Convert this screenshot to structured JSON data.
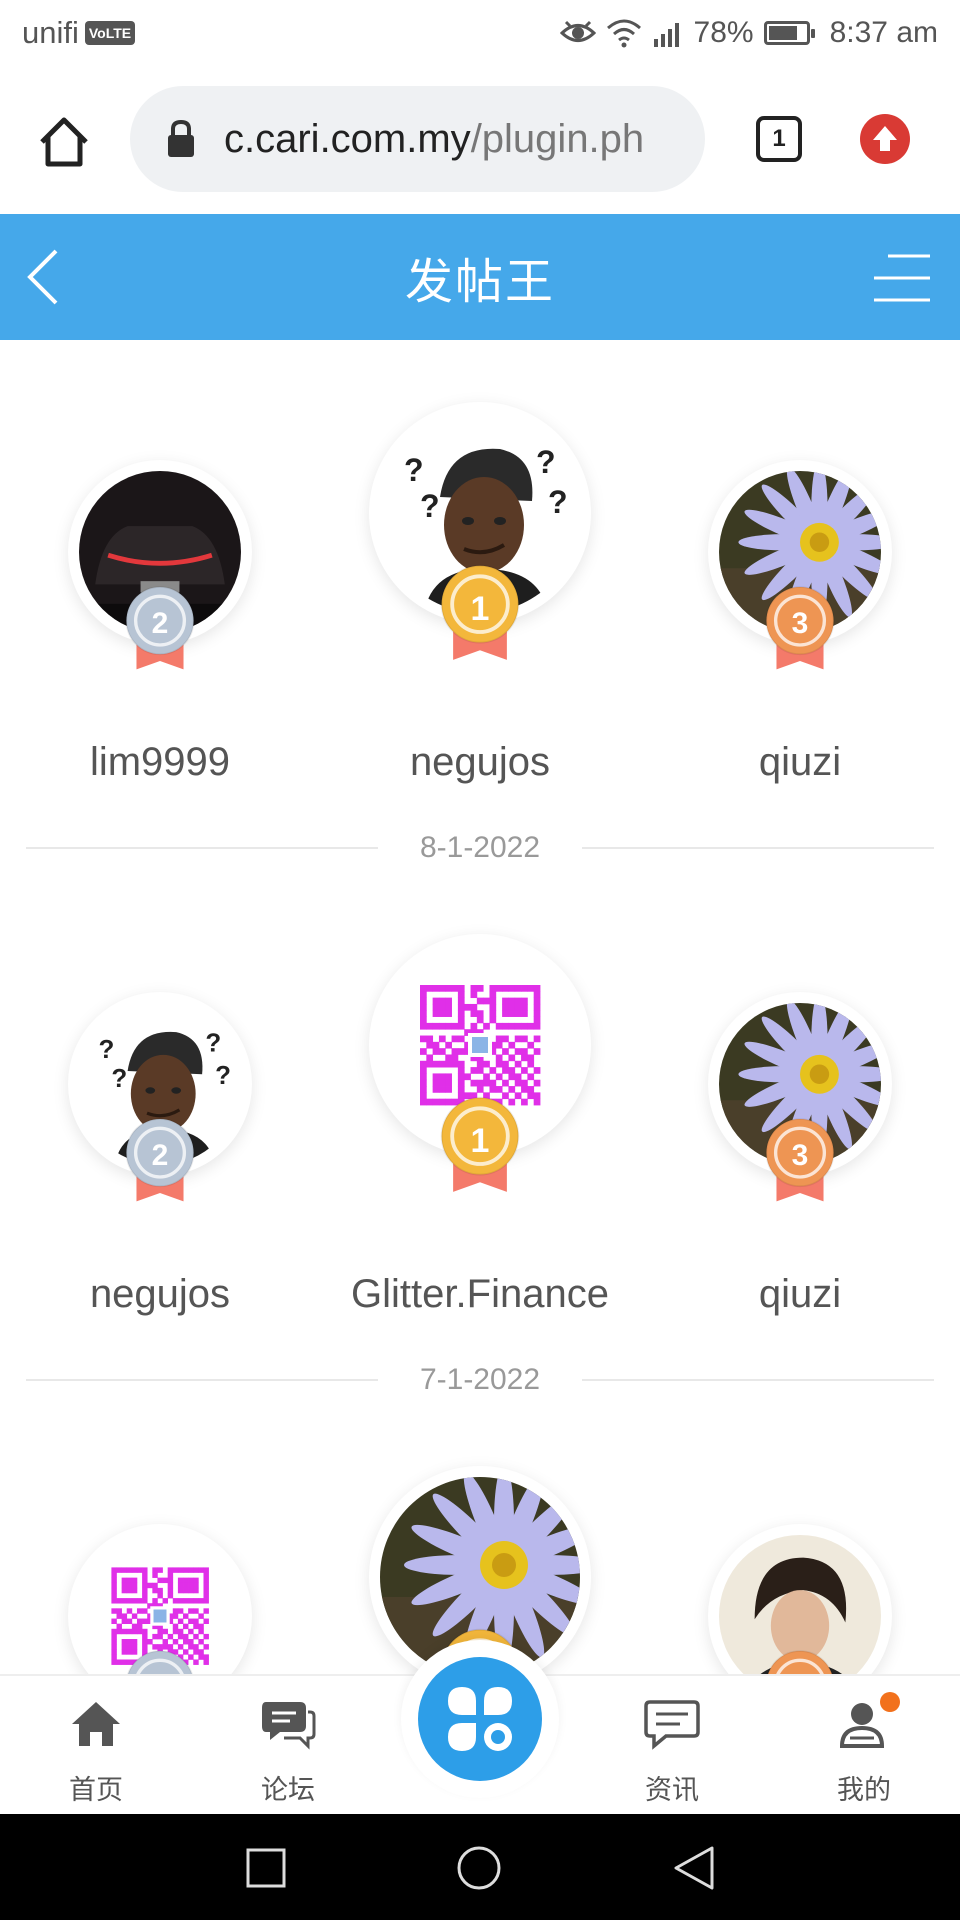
{
  "status_bar": {
    "carrier": "unifi",
    "volte": "VoLTE",
    "battery_text": "78%",
    "battery_level": 0.78,
    "time": "8:37 am",
    "icons": [
      "eye-icon",
      "wifi-icon",
      "signal-icon",
      "battery-icon"
    ]
  },
  "browser": {
    "url_host": "c.cari.com.my",
    "url_path": "/plugin.ph",
    "tab_count": "1",
    "icons": [
      "home-icon",
      "lock-icon",
      "tabs-icon",
      "update-icon"
    ]
  },
  "header": {
    "title": "发帖王",
    "color": "#45a8ea",
    "icons": [
      "back-arrow-icon",
      "menu-icon"
    ]
  },
  "groups": [
    {
      "users": [
        {
          "rank": "2",
          "name": "lim9999",
          "avatar": "car"
        },
        {
          "rank": "1",
          "name": "negujos",
          "avatar": "person"
        },
        {
          "rank": "3",
          "name": "qiuzi",
          "avatar": "flower"
        }
      ],
      "date": "8-1-2022"
    },
    {
      "users": [
        {
          "rank": "2",
          "name": "negujos",
          "avatar": "person"
        },
        {
          "rank": "1",
          "name": "Glitter.Finance",
          "avatar": "qr"
        },
        {
          "rank": "3",
          "name": "qiuzi",
          "avatar": "flower"
        }
      ],
      "date": "7-1-2022"
    },
    {
      "users": [
        {
          "rank": "2",
          "name": "",
          "avatar": "qr"
        },
        {
          "rank": "1",
          "name": "",
          "avatar": "flower"
        },
        {
          "rank": "3",
          "name": "",
          "avatar": "portrait"
        }
      ],
      "date": ""
    }
  ],
  "medal_colors": {
    "gold": "#f3b73b",
    "silver": "#b7c4d4",
    "bronze": "#ee9553",
    "ribbon": "#f47a6a"
  },
  "bottom_nav": {
    "items": [
      {
        "label": "首页",
        "icon": "home-icon"
      },
      {
        "label": "论坛",
        "icon": "forum-icon"
      },
      {
        "label": "",
        "icon": "apps-icon"
      },
      {
        "label": "资讯",
        "icon": "news-icon"
      },
      {
        "label": "我的",
        "icon": "profile-icon"
      }
    ],
    "notification_color": "#f2711c",
    "center_color": "#2d9ee8"
  },
  "system_nav": {
    "icons": [
      "recents-icon",
      "home-circle-icon",
      "back-triangle-icon"
    ]
  }
}
